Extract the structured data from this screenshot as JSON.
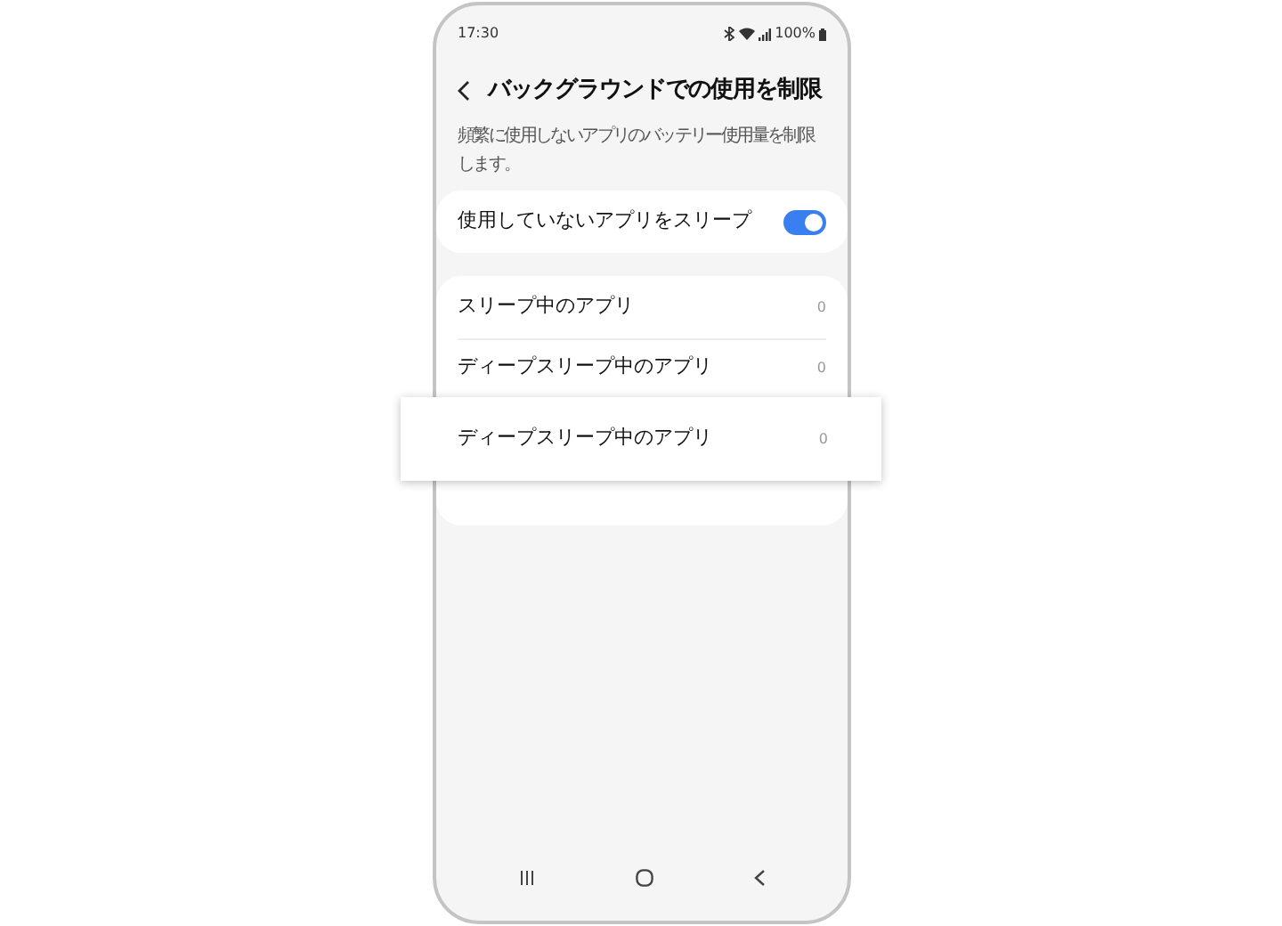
{
  "status_bar": {
    "time": "17:30",
    "battery": "100%"
  },
  "header": {
    "title": "バックグラウンドでの使用を制限"
  },
  "description": "頻繁に使用しないアプリのバッテリー使用量を制限します。",
  "toggle": {
    "label": "使用していないアプリをスリープ",
    "on": true
  },
  "list": [
    {
      "label": "スリープ中のアプリ",
      "count": "0"
    },
    {
      "label": "ディープスリープ中のアプリ",
      "count": "0"
    }
  ],
  "highlight": {
    "label": "ディープスリープ中のアプリ",
    "count": "0"
  }
}
